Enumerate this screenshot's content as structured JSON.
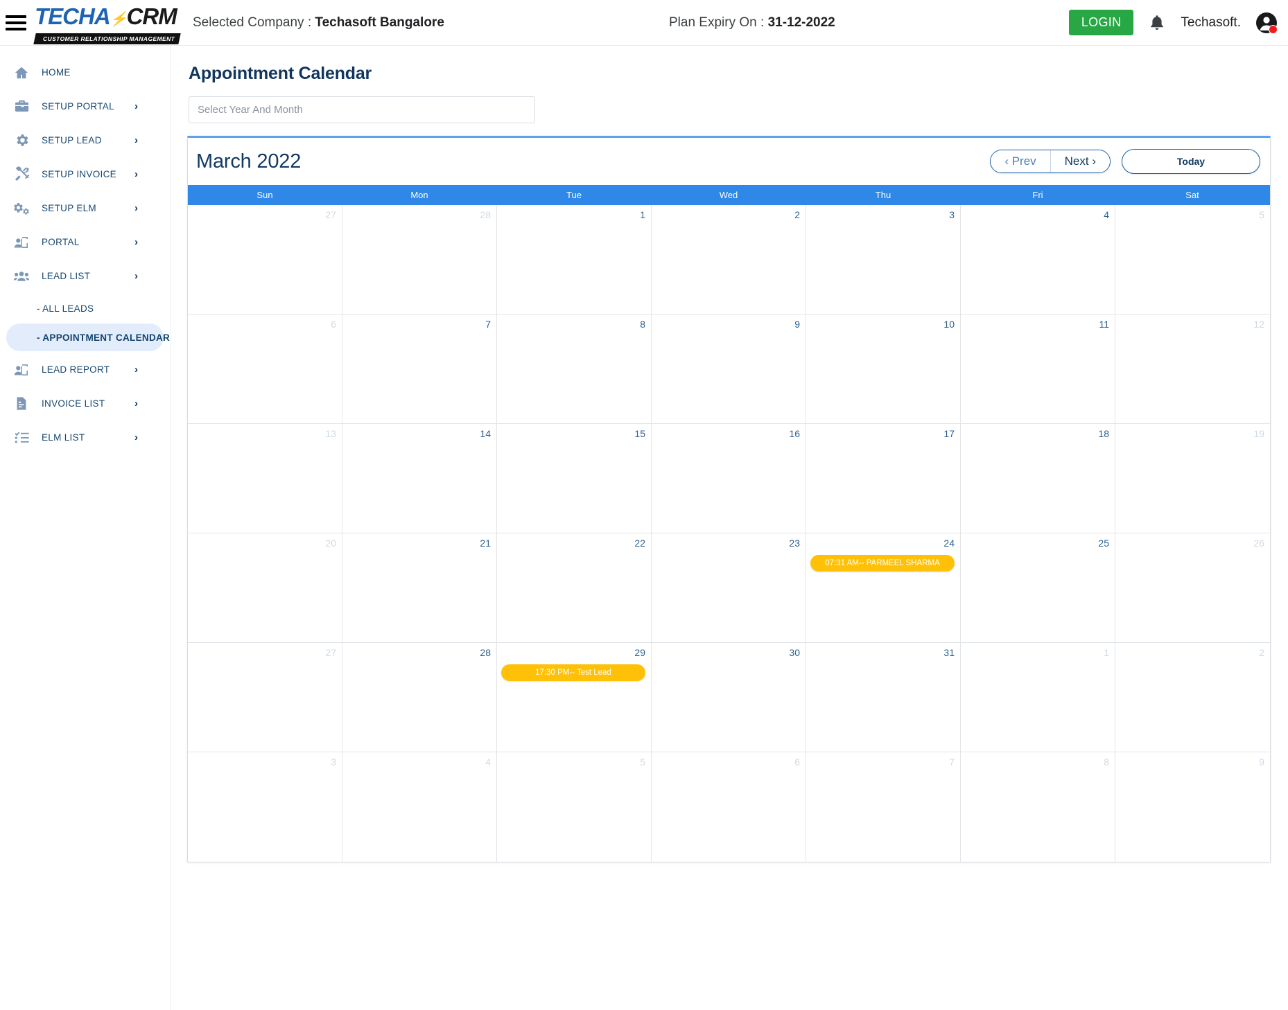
{
  "header": {
    "logo_main_blue": "TECHA",
    "logo_main_dark": "CRM",
    "logo_sub": "CUSTOMER RELATIONSHIP MANAGEMENT",
    "company_label": "Selected Company : ",
    "company_name": "Techasoft Bangalore",
    "plan_label": "Plan Expiry On : ",
    "plan_date": "31-12-2022",
    "login_label": "LOGIN",
    "user_name": "Techasoft.",
    "accent_green": "#28a745",
    "notification_dot_color": "#f01c1c"
  },
  "sidebar": {
    "items": [
      {
        "label": "HOME",
        "icon": "home-icon",
        "chevron": false
      },
      {
        "label": "SETUP PORTAL",
        "icon": "toolbox-icon",
        "chevron": true
      },
      {
        "label": "SETUP LEAD",
        "icon": "gear-icon",
        "chevron": true
      },
      {
        "label": "SETUP INVOICE",
        "icon": "tools-icon",
        "chevron": true
      },
      {
        "label": "SETUP ELM",
        "icon": "gears-icon",
        "chevron": true
      },
      {
        "label": "PORTAL",
        "icon": "user-screen-icon",
        "chevron": true
      },
      {
        "label": "LEAD LIST",
        "icon": "users-icon",
        "chevron": true
      }
    ],
    "sub_items": [
      {
        "label": "- ALL LEADS",
        "active": false
      },
      {
        "label": "- APPOINTMENT CALENDAR",
        "active": true
      }
    ],
    "items_after": [
      {
        "label": "LEAD REPORT",
        "icon": "user-screen-icon",
        "chevron": true
      },
      {
        "label": "INVOICE LIST",
        "icon": "document-icon",
        "chevron": true
      },
      {
        "label": "ELM LIST",
        "icon": "checklist-icon",
        "chevron": true
      }
    ],
    "chevron_glyph": "›",
    "active_bg": "#e3ecfb"
  },
  "main": {
    "page_title": "Appointment Calendar",
    "year_month_placeholder": "Select Year And Month",
    "year_month_value": ""
  },
  "calendar": {
    "title": "March 2022",
    "prev_label": "‹ Prev",
    "next_label": "Next ›",
    "today_label": "Today",
    "header_accent": "#2f87e8",
    "event_color": "#ffc107",
    "day_names": [
      "Sun",
      "Mon",
      "Tue",
      "Wed",
      "Thu",
      "Fri",
      "Sat"
    ],
    "weeks": [
      [
        {
          "num": "27",
          "other": true,
          "events": []
        },
        {
          "num": "28",
          "other": true,
          "events": []
        },
        {
          "num": "1",
          "other": false,
          "events": []
        },
        {
          "num": "2",
          "other": false,
          "events": []
        },
        {
          "num": "3",
          "other": false,
          "events": []
        },
        {
          "num": "4",
          "other": false,
          "events": []
        },
        {
          "num": "5",
          "other": true,
          "events": []
        }
      ],
      [
        {
          "num": "6",
          "other": true,
          "events": []
        },
        {
          "num": "7",
          "other": false,
          "events": []
        },
        {
          "num": "8",
          "other": false,
          "events": []
        },
        {
          "num": "9",
          "other": false,
          "events": []
        },
        {
          "num": "10",
          "other": false,
          "events": []
        },
        {
          "num": "11",
          "other": false,
          "events": []
        },
        {
          "num": "12",
          "other": true,
          "events": []
        }
      ],
      [
        {
          "num": "13",
          "other": true,
          "events": []
        },
        {
          "num": "14",
          "other": false,
          "events": []
        },
        {
          "num": "15",
          "other": false,
          "events": []
        },
        {
          "num": "16",
          "other": false,
          "events": []
        },
        {
          "num": "17",
          "other": false,
          "events": []
        },
        {
          "num": "18",
          "other": false,
          "events": []
        },
        {
          "num": "19",
          "other": true,
          "events": []
        }
      ],
      [
        {
          "num": "20",
          "other": true,
          "events": []
        },
        {
          "num": "21",
          "other": false,
          "events": []
        },
        {
          "num": "22",
          "other": false,
          "events": []
        },
        {
          "num": "23",
          "other": false,
          "events": []
        },
        {
          "num": "24",
          "other": false,
          "events": [
            "07:31 AM-- PARMEEL SHARMA"
          ]
        },
        {
          "num": "25",
          "other": false,
          "events": []
        },
        {
          "num": "26",
          "other": true,
          "events": []
        }
      ],
      [
        {
          "num": "27",
          "other": true,
          "events": []
        },
        {
          "num": "28",
          "other": false,
          "events": []
        },
        {
          "num": "29",
          "other": false,
          "events": [
            "17:30 PM-- Test Lead"
          ]
        },
        {
          "num": "30",
          "other": false,
          "events": []
        },
        {
          "num": "31",
          "other": false,
          "events": []
        },
        {
          "num": "1",
          "other": true,
          "events": []
        },
        {
          "num": "2",
          "other": true,
          "events": []
        }
      ],
      [
        {
          "num": "3",
          "other": true,
          "events": []
        },
        {
          "num": "4",
          "other": true,
          "events": []
        },
        {
          "num": "5",
          "other": true,
          "events": []
        },
        {
          "num": "6",
          "other": true,
          "events": []
        },
        {
          "num": "7",
          "other": true,
          "events": []
        },
        {
          "num": "8",
          "other": true,
          "events": []
        },
        {
          "num": "9",
          "other": true,
          "events": []
        }
      ]
    ]
  }
}
